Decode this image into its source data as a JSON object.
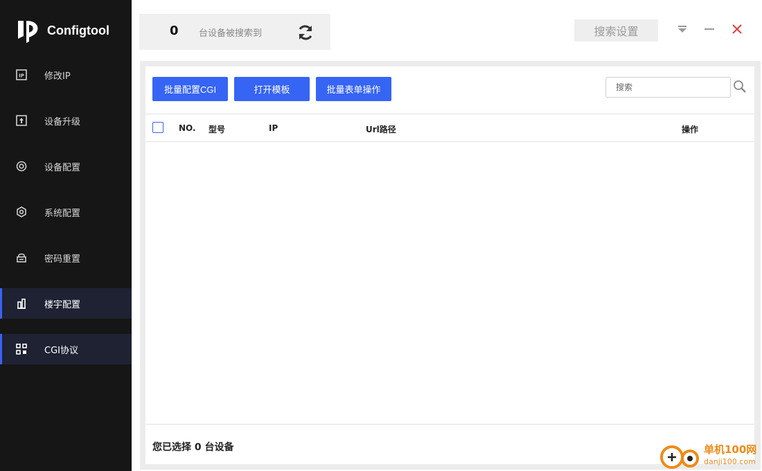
{
  "app": {
    "name": "Configtool"
  },
  "sidebar": {
    "items": [
      {
        "label": "修改IP",
        "icon": "ip-icon",
        "active": false
      },
      {
        "label": "设备升级",
        "icon": "upgrade-icon",
        "active": false
      },
      {
        "label": "设备配置",
        "icon": "device-config-icon",
        "active": false
      },
      {
        "label": "系统配置",
        "icon": "system-config-icon",
        "active": false
      },
      {
        "label": "密码重置",
        "icon": "lock-reset-icon",
        "active": false
      },
      {
        "label": "楼宇配置",
        "icon": "building-icon",
        "active": true
      },
      {
        "label": "CGI协议",
        "icon": "grid-icon",
        "active": true
      }
    ]
  },
  "topbar": {
    "device_count": "0",
    "device_count_text": "台设备被搜索到",
    "search_settings_label": "搜索设置"
  },
  "toolbar": {
    "batch_cgi_label": "批量配置CGI",
    "open_template_label": "打开模板",
    "batch_form_label": "批量表单操作",
    "search_placeholder": "搜索"
  },
  "table": {
    "columns": [
      "NO.",
      "型号",
      "IP",
      "Url路径",
      "操作"
    ],
    "rows": []
  },
  "footer": {
    "selected_text": "您已选择 0 台设备"
  },
  "watermark": {
    "site_name": "单机100网",
    "site_url": "danji100.com"
  },
  "colors": {
    "accent": "#3664f4",
    "sidebar_bg": "#161616",
    "close": "#e23b3b"
  }
}
